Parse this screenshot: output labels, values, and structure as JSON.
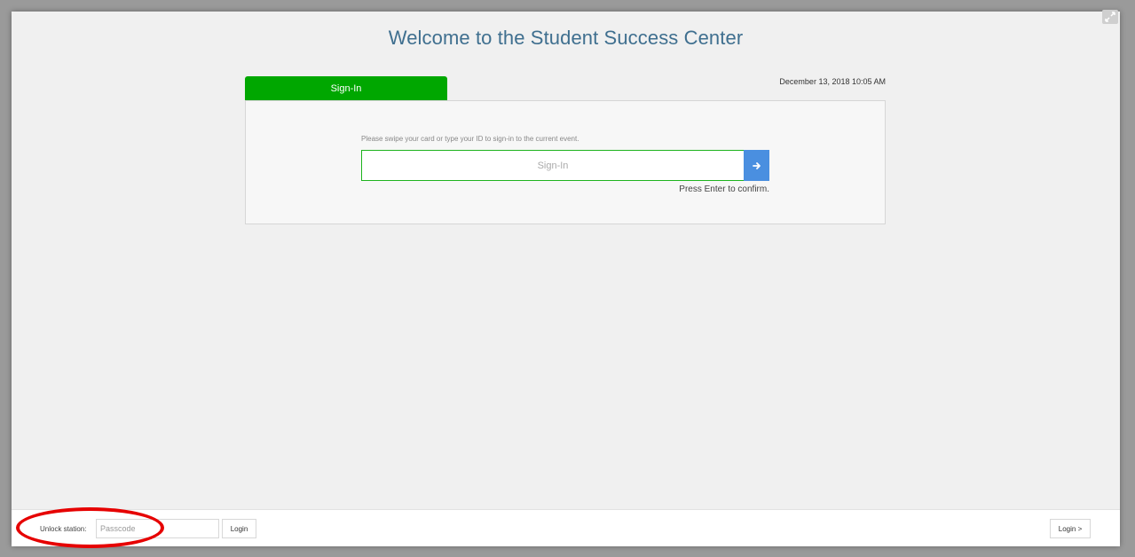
{
  "header": {
    "title": "Welcome to the Student Success Center",
    "datetime": "December 13, 2018 10:05 AM"
  },
  "signin": {
    "tab_label": "Sign-In",
    "instruction": "Please swipe your card or type your ID to sign-in to the current event.",
    "input_placeholder": "Sign-In",
    "input_value": "",
    "confirm_hint": "Press Enter to confirm."
  },
  "footer": {
    "unlock_label": "Unlock station:",
    "passcode_placeholder": "Passcode",
    "login_label": "Login",
    "login_right_label": "Login >"
  },
  "icons": {
    "expand": "expand-icon",
    "submit": "arrow-right-icon"
  },
  "colors": {
    "accent_green": "#00a700",
    "input_border": "#1db31d",
    "submit_blue": "#4a8fe0",
    "title_blue": "#3f6f8f",
    "annotation_red": "#e60000"
  }
}
